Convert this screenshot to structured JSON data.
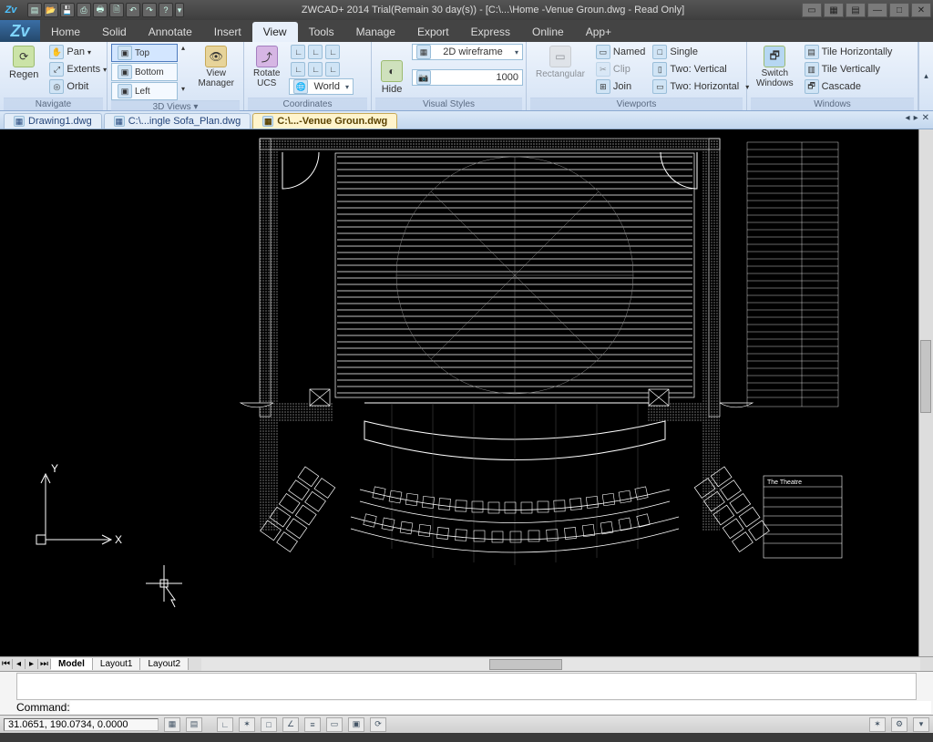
{
  "app": {
    "title": "ZWCAD+ 2014 Trial(Remain 30 day(s)) - [C:\\...\\Home -Venue  Groun.dwg - Read Only]"
  },
  "menubar": {
    "tabs": [
      "Home",
      "Solid",
      "Annotate",
      "Insert",
      "View",
      "Tools",
      "Manage",
      "Export",
      "Express",
      "Online",
      "App+"
    ],
    "active": "View"
  },
  "ribbon": {
    "navigate": {
      "label": "Navigate",
      "regen": "Regen",
      "pan": "Pan",
      "extents": "Extents",
      "orbit": "Orbit"
    },
    "views": {
      "top": "Top",
      "bottom": "Bottom",
      "left": "Left",
      "viewmgr": "View\nManager"
    },
    "coords": {
      "label": "Coordinates",
      "rotateucs": "Rotate\nUCS",
      "world": "World"
    },
    "visual": {
      "label": "Visual Styles",
      "hide": "Hide",
      "style_sel": "2D wireframe",
      "lens": "1000"
    },
    "viewports": {
      "label": "Viewports",
      "rect": "Rectangular",
      "named": "Named",
      "clip": "Clip",
      "join": "Join",
      "single": "Single",
      "twoV": "Two:  Vertical",
      "twoH": "Two:  Horizontal"
    },
    "windows": {
      "label": "Windows",
      "switch": "Switch\nWindows",
      "tileH": "Tile Horizontally",
      "tileV": "Tile Vertically",
      "cascade": "Cascade"
    }
  },
  "doctabs": {
    "items": [
      "Drawing1.dwg",
      "C:\\...ingle Sofa_Plan.dwg",
      "C:\\...-Venue  Groun.dwg"
    ],
    "active": 2
  },
  "drawing": {
    "axis_x": "X",
    "axis_y": "Y",
    "title_block": "The Theatre"
  },
  "sheets": {
    "items": [
      "Model",
      "Layout1",
      "Layout2"
    ],
    "active": 0
  },
  "command": {
    "prompt": "Command:"
  },
  "status": {
    "coords": "31.0651, 190.0734, 0.0000"
  }
}
